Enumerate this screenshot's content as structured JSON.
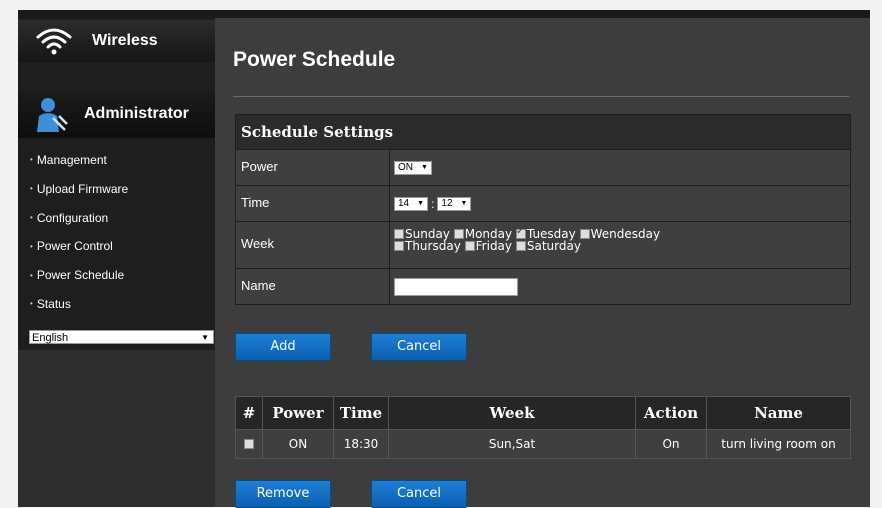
{
  "sidebar": {
    "wireless_label": "Wireless",
    "admin_label": "Administrator",
    "items": [
      {
        "label": "Management"
      },
      {
        "label": "Upload Firmware"
      },
      {
        "label": "Configuration"
      },
      {
        "label": "Power Control"
      },
      {
        "label": "Power Schedule"
      },
      {
        "label": "Status"
      }
    ],
    "language": "English"
  },
  "main": {
    "title": "Power Schedule",
    "settings": {
      "header": "Schedule Settings",
      "power_label": "Power",
      "power_value": "ON",
      "time_label": "Time",
      "hour": "14",
      "minute": "12",
      "week_label": "Week",
      "days": [
        {
          "label": "Sunday",
          "checked": false
        },
        {
          "label": "Monday",
          "checked": false
        },
        {
          "label": "Tuesday",
          "checked": true
        },
        {
          "label": "Wendesday",
          "checked": false
        },
        {
          "label": "Thursday",
          "checked": false
        },
        {
          "label": "Friday",
          "checked": false
        },
        {
          "label": "Saturday",
          "checked": false
        }
      ],
      "name_label": "Name",
      "name_value": ""
    },
    "add_label": "Add",
    "cancel_label": "Cancel",
    "table": {
      "headers": [
        "#",
        "Power",
        "Time",
        "Week",
        "Action",
        "Name"
      ],
      "rows": [
        {
          "power": "ON",
          "time": "18:30",
          "week": "Sun,Sat",
          "action": "On",
          "name": "turn living room on"
        }
      ]
    },
    "remove_label": "Remove",
    "cancel2_label": "Cancel"
  }
}
